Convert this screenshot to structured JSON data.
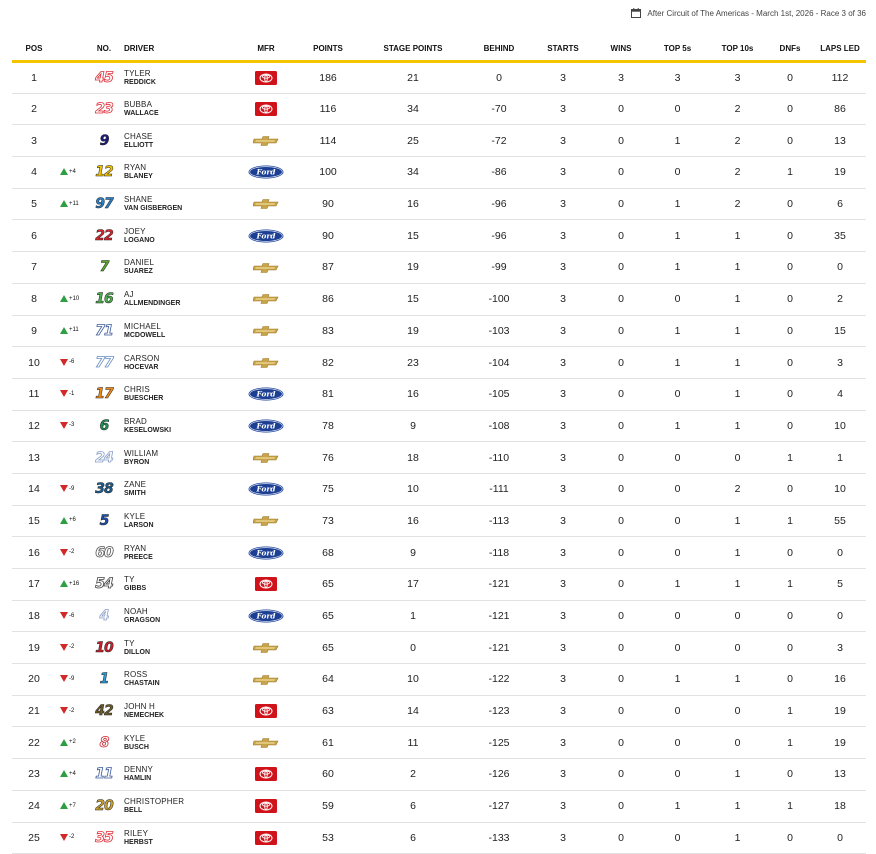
{
  "race_info": "After Circuit of The Americas - March 1st, 2026 - Race 3 of 36",
  "columns": [
    "POS",
    "NO.",
    "DRIVER",
    "MFR",
    "POINTS",
    "STAGE POINTS",
    "BEHIND",
    "STARTS",
    "WINS",
    "TOP 5s",
    "TOP 10s",
    "DNFs",
    "LAPS LED"
  ],
  "colors": {
    "accent": "#f5c400",
    "up": "#2e9e43",
    "down": "#d22828",
    "toyota": "#d0121b",
    "ford": "#1c3f94",
    "chevrolet": "#c8a44a"
  },
  "rows": [
    {
      "pos": "1",
      "change": "",
      "dir": "",
      "num": "45",
      "numColor": "#e0303a",
      "outline": true,
      "first": "TYLER",
      "last": "REDDICK",
      "mfr": "toyota",
      "points": "186",
      "stage": "21",
      "behind": "0",
      "starts": "3",
      "wins": "3",
      "top5": "3",
      "top10": "3",
      "dnf": "0",
      "led": "112"
    },
    {
      "pos": "2",
      "change": "",
      "dir": "",
      "num": "23",
      "numColor": "#e0303a",
      "outline": true,
      "first": "BUBBA",
      "last": "WALLACE",
      "mfr": "toyota",
      "points": "116",
      "stage": "34",
      "behind": "-70",
      "starts": "3",
      "wins": "0",
      "top5": "0",
      "top10": "2",
      "dnf": "0",
      "led": "86"
    },
    {
      "pos": "3",
      "change": "",
      "dir": "",
      "num": "9",
      "numColor": "#1c1a7a",
      "outline": false,
      "first": "CHASE",
      "last": "ELLIOTT",
      "mfr": "chevrolet",
      "points": "114",
      "stage": "25",
      "behind": "-72",
      "starts": "3",
      "wins": "0",
      "top5": "1",
      "top10": "2",
      "dnf": "0",
      "led": "13"
    },
    {
      "pos": "4",
      "change": "+4",
      "dir": "up",
      "num": "12",
      "numColor": "#f2c500",
      "outline": false,
      "first": "RYAN",
      "last": "BLANEY",
      "mfr": "ford",
      "points": "100",
      "stage": "34",
      "behind": "-86",
      "starts": "3",
      "wins": "0",
      "top5": "0",
      "top10": "2",
      "dnf": "1",
      "led": "19"
    },
    {
      "pos": "5",
      "change": "+11",
      "dir": "up",
      "num": "97",
      "numColor": "#2a7fc9",
      "outline": false,
      "first": "SHANE",
      "last": "VAN GISBERGEN",
      "mfr": "chevrolet",
      "points": "90",
      "stage": "16",
      "behind": "-96",
      "starts": "3",
      "wins": "0",
      "top5": "1",
      "top10": "2",
      "dnf": "0",
      "led": "6"
    },
    {
      "pos": "6",
      "change": "",
      "dir": "",
      "num": "22",
      "numColor": "#d8262e",
      "outline": false,
      "first": "JOEY",
      "last": "LOGANO",
      "mfr": "ford",
      "points": "90",
      "stage": "15",
      "behind": "-96",
      "starts": "3",
      "wins": "0",
      "top5": "1",
      "top10": "1",
      "dnf": "0",
      "led": "35"
    },
    {
      "pos": "7",
      "change": "",
      "dir": "",
      "num": "7",
      "numColor": "#5aa62e",
      "outline": false,
      "first": "DANIEL",
      "last": "SUAREZ",
      "mfr": "chevrolet",
      "points": "87",
      "stage": "19",
      "behind": "-99",
      "starts": "3",
      "wins": "0",
      "top5": "1",
      "top10": "1",
      "dnf": "0",
      "led": "0"
    },
    {
      "pos": "8",
      "change": "+10",
      "dir": "up",
      "num": "16",
      "numColor": "#4bb04b",
      "outline": false,
      "first": "AJ",
      "last": "ALLMENDINGER",
      "mfr": "chevrolet",
      "points": "86",
      "stage": "15",
      "behind": "-100",
      "starts": "3",
      "wins": "0",
      "top5": "0",
      "top10": "1",
      "dnf": "0",
      "led": "2"
    },
    {
      "pos": "9",
      "change": "+11",
      "dir": "up",
      "num": "71",
      "numColor": "#3d5b9a",
      "outline": true,
      "first": "MICHAEL",
      "last": "MCDOWELL",
      "mfr": "chevrolet",
      "points": "83",
      "stage": "19",
      "behind": "-103",
      "starts": "3",
      "wins": "0",
      "top5": "1",
      "top10": "1",
      "dnf": "0",
      "led": "15"
    },
    {
      "pos": "10",
      "change": "-6",
      "dir": "down",
      "num": "77",
      "numColor": "#6a8fc8",
      "outline": true,
      "first": "CARSON",
      "last": "HOCEVAR",
      "mfr": "chevrolet",
      "points": "82",
      "stage": "23",
      "behind": "-104",
      "starts": "3",
      "wins": "0",
      "top5": "1",
      "top10": "1",
      "dnf": "0",
      "led": "3"
    },
    {
      "pos": "11",
      "change": "-1",
      "dir": "down",
      "num": "17",
      "numColor": "#f28a1a",
      "outline": false,
      "first": "CHRIS",
      "last": "BUESCHER",
      "mfr": "ford",
      "points": "81",
      "stage": "16",
      "behind": "-105",
      "starts": "3",
      "wins": "0",
      "top5": "0",
      "top10": "1",
      "dnf": "0",
      "led": "4"
    },
    {
      "pos": "12",
      "change": "-3",
      "dir": "down",
      "num": "6",
      "numColor": "#1f8f55",
      "outline": false,
      "first": "BRAD",
      "last": "KESELOWSKI",
      "mfr": "ford",
      "points": "78",
      "stage": "9",
      "behind": "-108",
      "starts": "3",
      "wins": "0",
      "top5": "1",
      "top10": "1",
      "dnf": "0",
      "led": "10"
    },
    {
      "pos": "13",
      "change": "",
      "dir": "",
      "num": "24",
      "numColor": "#8aa0c8",
      "outline": true,
      "first": "WILLIAM",
      "last": "BYRON",
      "mfr": "chevrolet",
      "points": "76",
      "stage": "18",
      "behind": "-110",
      "starts": "3",
      "wins": "0",
      "top5": "0",
      "top10": "0",
      "dnf": "1",
      "led": "1"
    },
    {
      "pos": "14",
      "change": "-9",
      "dir": "down",
      "num": "38",
      "numColor": "#1d5c8c",
      "outline": false,
      "first": "ZANE",
      "last": "SMITH",
      "mfr": "ford",
      "points": "75",
      "stage": "10",
      "behind": "-111",
      "starts": "3",
      "wins": "0",
      "top5": "0",
      "top10": "2",
      "dnf": "0",
      "led": "10"
    },
    {
      "pos": "15",
      "change": "+6",
      "dir": "up",
      "num": "5",
      "numColor": "#1e4fa8",
      "outline": false,
      "first": "KYLE",
      "last": "LARSON",
      "mfr": "chevrolet",
      "points": "73",
      "stage": "16",
      "behind": "-113",
      "starts": "3",
      "wins": "0",
      "top5": "0",
      "top10": "1",
      "dnf": "1",
      "led": "55"
    },
    {
      "pos": "16",
      "change": "-2",
      "dir": "down",
      "num": "60",
      "numColor": "#555555",
      "outline": true,
      "first": "RYAN",
      "last": "PREECE",
      "mfr": "ford",
      "points": "68",
      "stage": "9",
      "behind": "-118",
      "starts": "3",
      "wins": "0",
      "top5": "0",
      "top10": "1",
      "dnf": "0",
      "led": "0"
    },
    {
      "pos": "17",
      "change": "+16",
      "dir": "up",
      "num": "54",
      "numColor": "#444444",
      "outline": true,
      "first": "TY",
      "last": "GIBBS",
      "mfr": "toyota",
      "points": "65",
      "stage": "17",
      "behind": "-121",
      "starts": "3",
      "wins": "0",
      "top5": "1",
      "top10": "1",
      "dnf": "1",
      "led": "5"
    },
    {
      "pos": "18",
      "change": "-6",
      "dir": "down",
      "num": "4",
      "numColor": "#8aa0c8",
      "outline": true,
      "first": "NOAH",
      "last": "GRAGSON",
      "mfr": "ford",
      "points": "65",
      "stage": "1",
      "behind": "-121",
      "starts": "3",
      "wins": "0",
      "top5": "0",
      "top10": "0",
      "dnf": "0",
      "led": "0"
    },
    {
      "pos": "19",
      "change": "-2",
      "dir": "down",
      "num": "10",
      "numColor": "#c8202a",
      "outline": false,
      "first": "TY",
      "last": "DILLON",
      "mfr": "chevrolet",
      "points": "65",
      "stage": "0",
      "behind": "-121",
      "starts": "3",
      "wins": "0",
      "top5": "0",
      "top10": "0",
      "dnf": "0",
      "led": "3"
    },
    {
      "pos": "20",
      "change": "-9",
      "dir": "down",
      "num": "1",
      "numColor": "#2a9ad8",
      "outline": false,
      "first": "ROSS",
      "last": "CHASTAIN",
      "mfr": "chevrolet",
      "points": "64",
      "stage": "10",
      "behind": "-122",
      "starts": "3",
      "wins": "0",
      "top5": "1",
      "top10": "1",
      "dnf": "0",
      "led": "16"
    },
    {
      "pos": "21",
      "change": "-2",
      "dir": "down",
      "num": "42",
      "numColor": "#6b5a2a",
      "outline": false,
      "first": "JOHN H",
      "last": "NEMECHEK",
      "mfr": "toyota",
      "points": "63",
      "stage": "14",
      "behind": "-123",
      "starts": "3",
      "wins": "0",
      "top5": "0",
      "top10": "0",
      "dnf": "1",
      "led": "19"
    },
    {
      "pos": "22",
      "change": "+2",
      "dir": "up",
      "num": "8",
      "numColor": "#c8202a",
      "outline": true,
      "first": "KYLE",
      "last": "BUSCH",
      "mfr": "chevrolet",
      "points": "61",
      "stage": "11",
      "behind": "-125",
      "starts": "3",
      "wins": "0",
      "top5": "0",
      "top10": "0",
      "dnf": "1",
      "led": "19"
    },
    {
      "pos": "23",
      "change": "+4",
      "dir": "up",
      "num": "11",
      "numColor": "#3d5b9a",
      "outline": true,
      "first": "DENNY",
      "last": "HAMLIN",
      "mfr": "toyota",
      "points": "60",
      "stage": "2",
      "behind": "-126",
      "starts": "3",
      "wins": "0",
      "top5": "0",
      "top10": "1",
      "dnf": "0",
      "led": "13"
    },
    {
      "pos": "24",
      "change": "+7",
      "dir": "up",
      "num": "20",
      "numColor": "#c8a030",
      "outline": false,
      "first": "CHRISTOPHER",
      "last": "BELL",
      "mfr": "toyota",
      "points": "59",
      "stage": "6",
      "behind": "-127",
      "starts": "3",
      "wins": "0",
      "top5": "1",
      "top10": "1",
      "dnf": "1",
      "led": "18"
    },
    {
      "pos": "25",
      "change": "-2",
      "dir": "down",
      "num": "35",
      "numColor": "#e0303a",
      "outline": true,
      "first": "RILEY",
      "last": "HERBST",
      "mfr": "toyota",
      "points": "53",
      "stage": "6",
      "behind": "-133",
      "starts": "3",
      "wins": "0",
      "top5": "0",
      "top10": "1",
      "dnf": "0",
      "led": "0"
    }
  ]
}
